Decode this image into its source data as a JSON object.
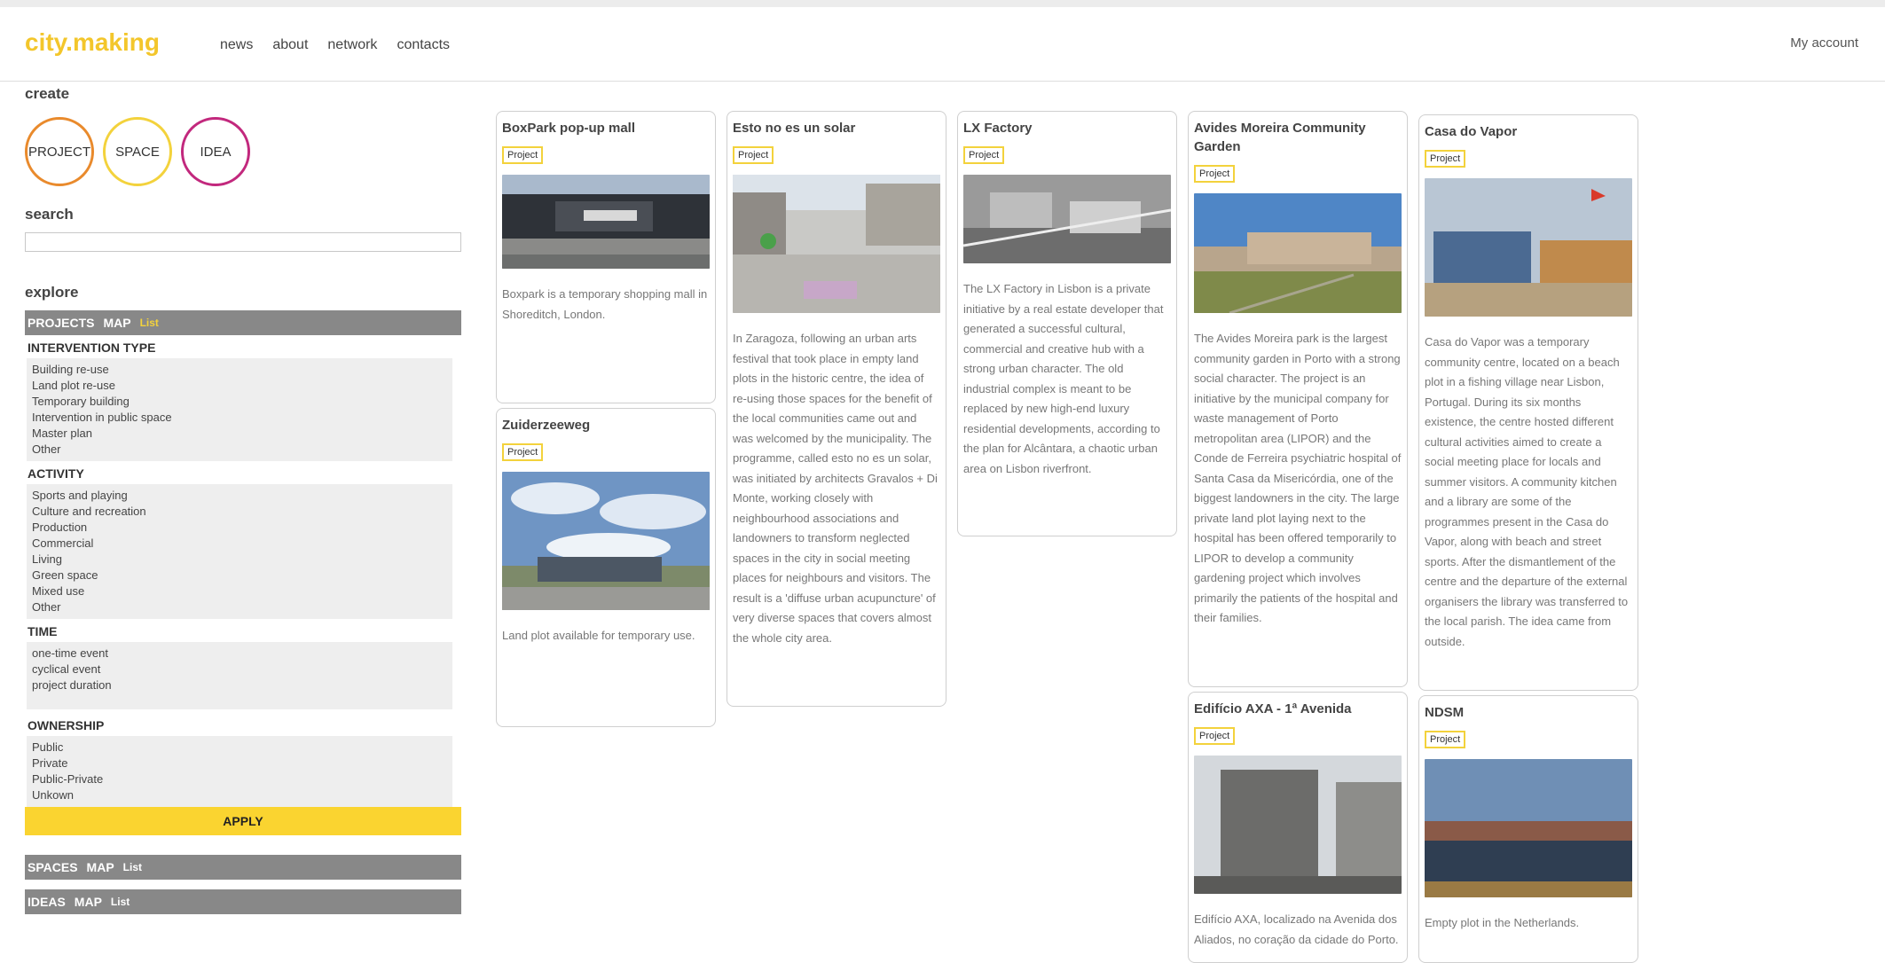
{
  "header": {
    "logo": "city.making",
    "nav": [
      "news",
      "about",
      "network",
      "contacts"
    ],
    "account": "My account"
  },
  "sidebar": {
    "create": {
      "title": "create",
      "buttons": [
        "PROJECT",
        "SPACE",
        "IDEA"
      ]
    },
    "search": {
      "title": "search",
      "value": ""
    },
    "explore": {
      "title": "explore",
      "projects_bar": {
        "label": "PROJECTS",
        "map": "MAP",
        "list": "List"
      },
      "groups": [
        {
          "title": "INTERVENTION TYPE",
          "options": [
            "Building re-use",
            "Land plot re-use",
            "Temporary building",
            "Intervention in public space",
            "Master plan",
            "Other"
          ]
        },
        {
          "title": "ACTIVITY",
          "options": [
            "Sports and playing",
            "Culture and recreation",
            "Production",
            "Commercial",
            "Living",
            "Green space",
            "Mixed use",
            "Other"
          ]
        },
        {
          "title": "TIME",
          "options": [
            "one-time event",
            "cyclical event",
            "project duration"
          ]
        },
        {
          "title": "OWNERSHIP",
          "options": [
            "Public",
            "Private",
            "Public-Private",
            "Unkown"
          ]
        }
      ],
      "apply": "APPLY",
      "spaces_bar": {
        "label": "SPACES",
        "map": "MAP",
        "list": "List"
      },
      "ideas_bar": {
        "label": "IDEAS",
        "map": "MAP",
        "list": "List"
      }
    }
  },
  "cards": [
    {
      "title": "BoxPark pop-up mall",
      "badge": "Project",
      "image": "boxpark-photo",
      "description": "Boxpark is a temporary shopping mall in Shoreditch, London."
    },
    {
      "title": "Zuiderzeeweg",
      "badge": "Project",
      "image": "office-building-sky-photo",
      "description": "Land plot available for temporary use."
    },
    {
      "title": "Esto no es un solar",
      "badge": "Project",
      "image": "plaza-photo",
      "description": "In Zaragoza, following an urban arts festival that took place in empty land plots in the historic centre, the idea of re-using those spaces for the benefit of the local communities came out and was welcomed by the municipality. The programme, called esto no es un solar, was initiated by architects Gravalos + Di Monte, working closely with neighbourhood associations and landowners to transform neglected spaces in the city in social meeting places for neighbours and visitors. The result is a 'diffuse urban acupuncture' of very diverse spaces that covers almost the whole city area."
    },
    {
      "title": "LX Factory",
      "badge": "Project",
      "image": "aerial-photo",
      "description": "The LX Factory in Lisbon is a private initiative by a real estate developer that generated a successful cultural, commercial and creative hub with a strong urban character. The old industrial complex is meant to be replaced by new high-end luxury residential developments, according to the plan for Alcântara, a chaotic urban area on Lisbon riverfront."
    },
    {
      "title": "Avides Moreira Community Garden",
      "badge": "Project",
      "image": "garden-photo",
      "description": "The Avides Moreira park is the largest community garden in Porto with a strong social character. The project is an initiative by the municipal company for waste management of Porto metropolitan area (LIPOR) and the Conde de Ferreira psychiatric hospital of Santa Casa da Misericórdia, one of the biggest landowners in the city. The large private land plot laying next to the hospital has been offered temporarily to LIPOR to develop a community gardening project which involves primarily the patients of the hospital and their families."
    },
    {
      "title": "Edifício AXA - 1ª Avenida",
      "badge": "Project",
      "image": "historic-building-photo",
      "description": "Edifício AXA, localizado na Avenida dos Aliados, no coração da cidade do Porto."
    },
    {
      "title": "Casa do Vapor",
      "badge": "Project",
      "image": "wooden-structure-photo",
      "description": "Casa do Vapor was a temporary community centre, located on a beach plot in a fishing village near Lisbon, Portugal. During its six months existence, the centre hosted different cultural activities aimed to create a social meeting place for locals and summer visitors. A community kitchen and a library are some of the programmes present in the Casa do Vapor, along with beach and street sports. After the dismantlement of the centre and the departure of the external organisers the library was transferred to the local parish. The idea came from outside."
    },
    {
      "title": "NDSM",
      "badge": "Project",
      "image": "harbour-photo",
      "description": "Empty plot in the Netherlands."
    }
  ]
}
